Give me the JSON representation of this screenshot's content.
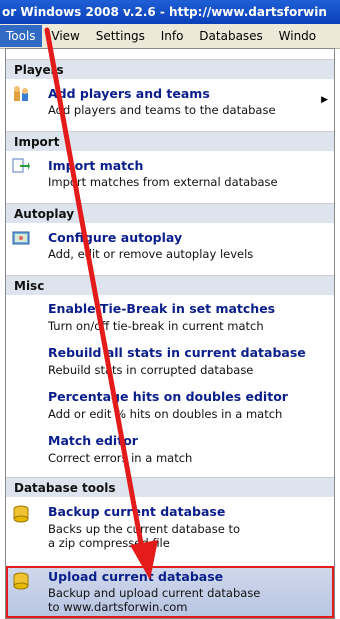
{
  "window": {
    "title": "or Windows 2008 v.2.6 - http://www.dartsforwin"
  },
  "menubar": {
    "items": [
      "Tools",
      "View",
      "Settings",
      "Info",
      "Databases",
      "Windo"
    ]
  },
  "sections": {
    "players": "Players",
    "import": "Import",
    "autoplay": "Autoplay",
    "misc": "Misc",
    "database_tools": "Database tools"
  },
  "items": {
    "add_players": {
      "title": "Add players and teams",
      "desc": "Add players and teams to the database"
    },
    "import_match": {
      "title": "Import match",
      "desc": "Import matches from external database"
    },
    "configure_autoplay": {
      "title": "Configure autoplay",
      "desc": "Add, edit or remove autoplay levels"
    },
    "tie_break": {
      "title": "Enable Tie-Break in set matches",
      "desc": "Turn on/off tie-break in current match"
    },
    "rebuild_stats": {
      "title": "Rebuild all stats in current database",
      "desc": "Rebuild stats in corrupted database"
    },
    "percentage_hits": {
      "title": "Percentage hits on doubles editor",
      "desc": "Add or edit % hits on doubles in a match"
    },
    "match_editor": {
      "title": "Match editor",
      "desc": "Correct errors in a match"
    },
    "backup_db": {
      "title": "Backup current database",
      "desc1": "Backs up the current database to",
      "desc2": "a zip compressed file"
    },
    "upload_db": {
      "title": "Upload current database",
      "desc1": "Backup and upload current database",
      "desc2": "to www.dartsforwin.com"
    }
  },
  "colors": {
    "accent": "#316ac5",
    "title_text": "#0b1f8a",
    "annotation": "#e31b1b"
  },
  "icons": {
    "add_players": "users-icon",
    "import_match": "import-icon",
    "configure_autoplay": "autoplay-icon",
    "backup_db": "database-icon",
    "upload_db": "database-upload-icon"
  }
}
